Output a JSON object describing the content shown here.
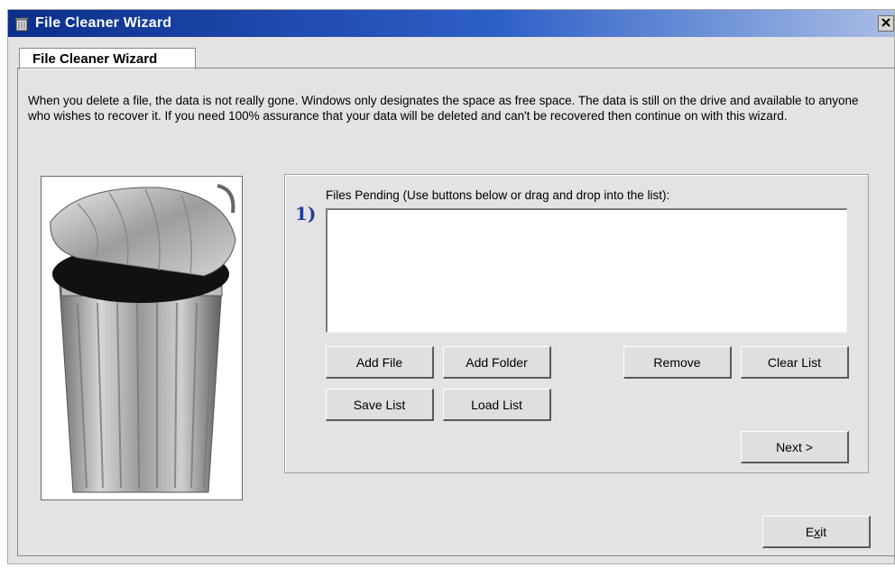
{
  "window": {
    "title": "File Cleaner Wizard"
  },
  "tab": {
    "label": "File Cleaner Wizard"
  },
  "description": "When you delete a file, the data is not really gone. Windows only designates the space as free space. The data is still on the drive and available to anyone who wishes to recover it. If you need 100% assurance that your data will be deleted and can't be recovered then continue on with this wizard.",
  "step": {
    "number": "1)",
    "list_label": "Files Pending (Use buttons below or drag and drop into the list):",
    "files": []
  },
  "buttons": {
    "add_file": "Add File",
    "add_folder": "Add Folder",
    "remove": "Remove",
    "clear_list": "Clear List",
    "save_list": "Save List",
    "load_list": "Load List",
    "next": "Next >",
    "exit_prefix": "E",
    "exit_underlined": "x",
    "exit_suffix": "it"
  },
  "icons": {
    "app": "recycle-bin-icon",
    "close": "close-icon",
    "illustration": "trash-can-icon"
  },
  "colors": {
    "title_bar_start": "#0c2e8c",
    "title_bar_end": "#a9bde4",
    "dialog_background": "#e4e2e2",
    "step_number": "#1f3b9a"
  }
}
